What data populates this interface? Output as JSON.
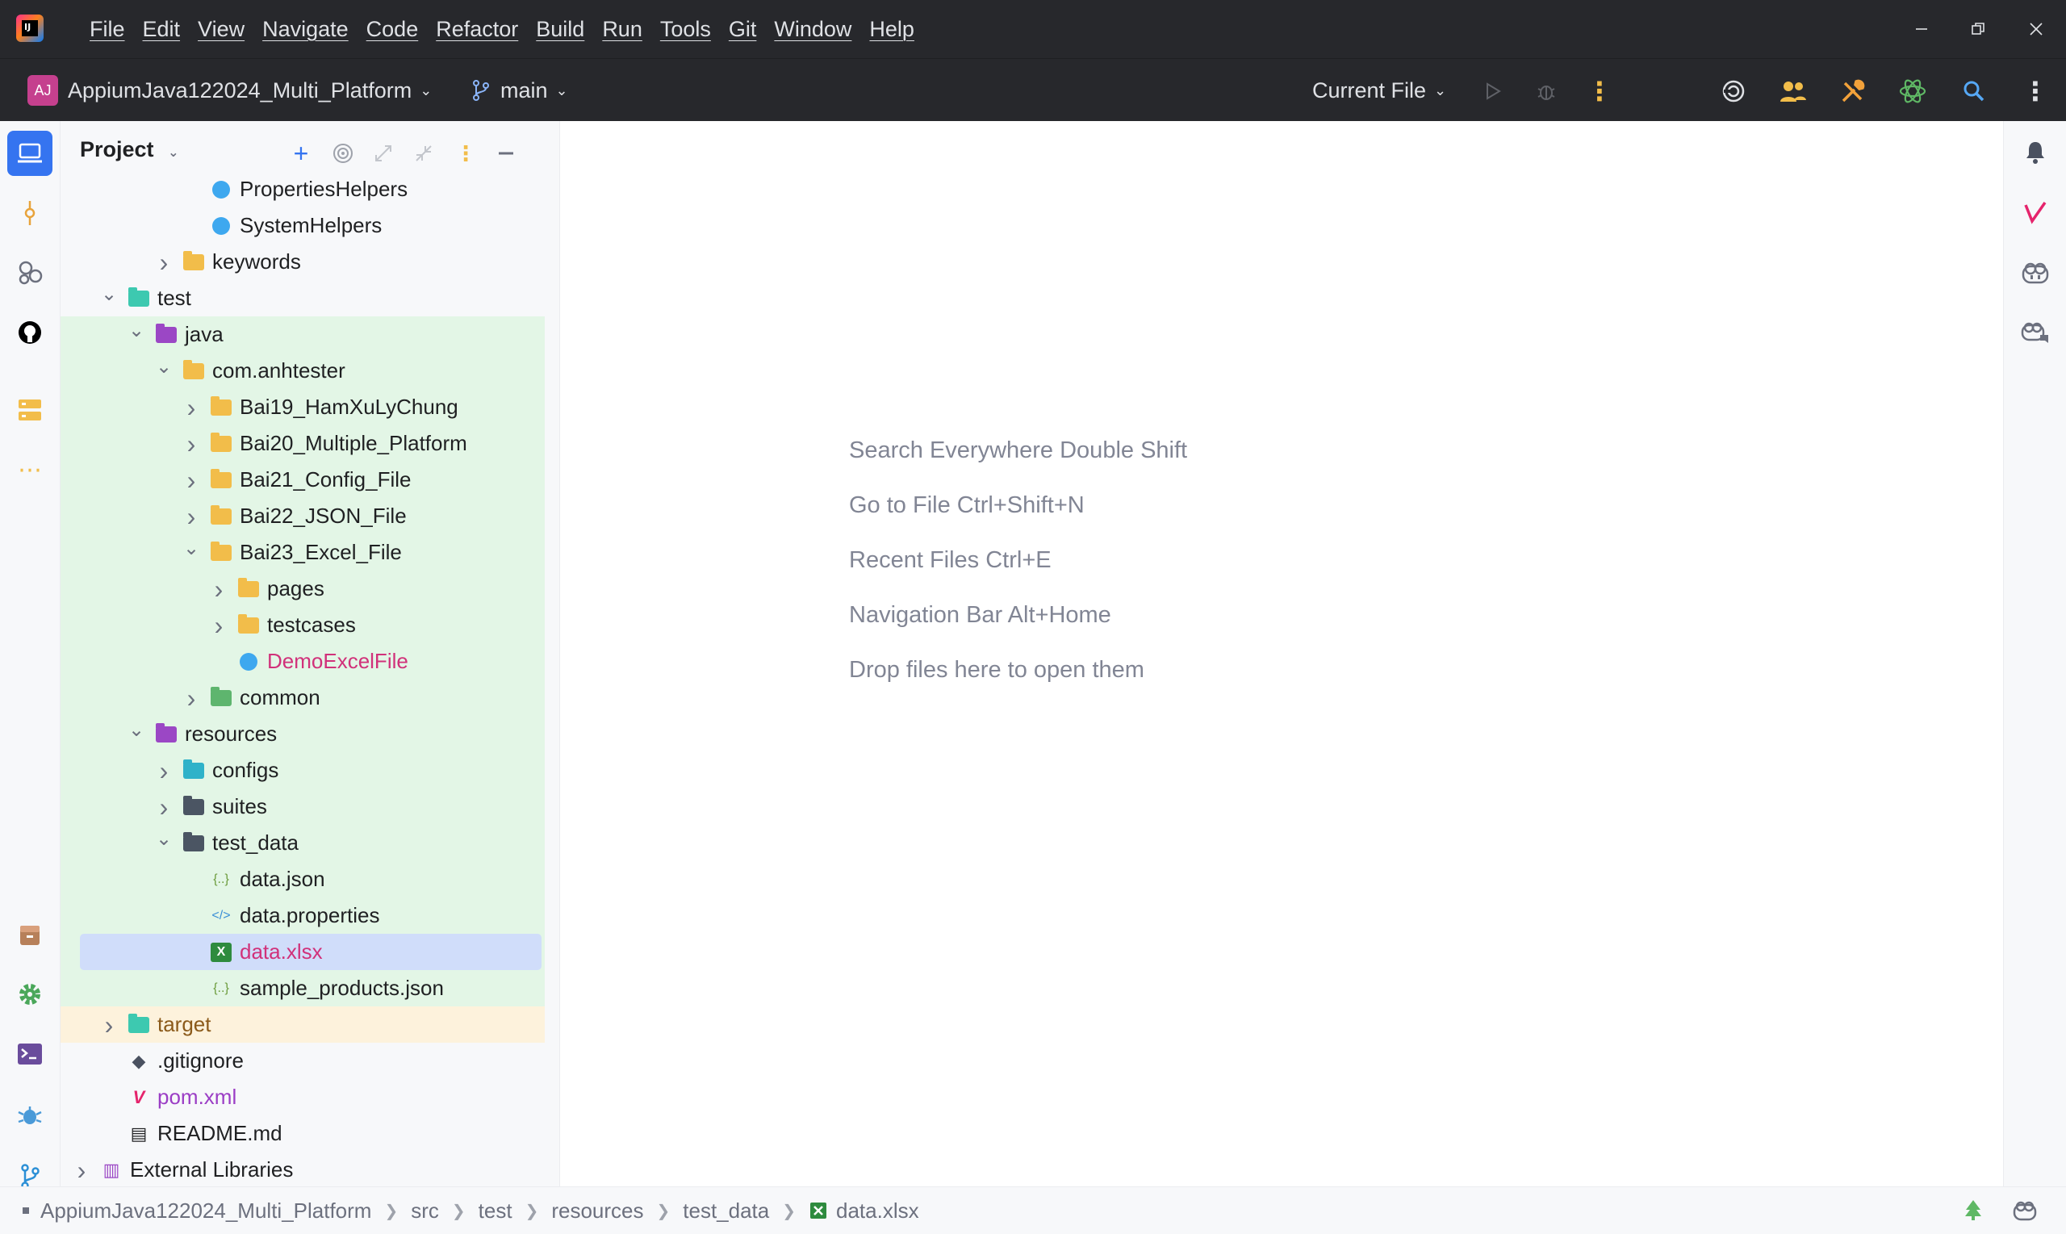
{
  "menu": [
    "File",
    "Edit",
    "View",
    "Navigate",
    "Code",
    "Refactor",
    "Build",
    "Run",
    "Tools",
    "Git",
    "Window",
    "Help"
  ],
  "toolbar": {
    "project_initials": "AJ",
    "project_name": "AppiumJava122024_Multi_Platform",
    "branch": "main",
    "run_config": "Current File"
  },
  "panel": {
    "title": "Project"
  },
  "tree": [
    {
      "label": "PropertiesHelpers",
      "type": "class",
      "depth": 4,
      "arrow": "none",
      "bg": "none",
      "color": "normal"
    },
    {
      "label": "SystemHelpers",
      "type": "class",
      "depth": 4,
      "arrow": "none",
      "bg": "none",
      "color": "normal"
    },
    {
      "label": "keywords",
      "type": "folder",
      "folder": "orange",
      "depth": 3,
      "arrow": "right",
      "bg": "none",
      "color": "normal"
    },
    {
      "label": "test",
      "type": "folder",
      "folder": "teal",
      "depth": 1,
      "arrow": "down",
      "bg": "none",
      "color": "normal"
    },
    {
      "label": "java",
      "type": "folder",
      "folder": "purple",
      "depth": 2,
      "arrow": "down",
      "bg": "green",
      "color": "normal"
    },
    {
      "label": "com.anhtester",
      "type": "folder",
      "folder": "orange",
      "depth": 3,
      "arrow": "down",
      "bg": "green",
      "color": "normal"
    },
    {
      "label": "Bai19_HamXuLyChung",
      "type": "folder",
      "folder": "orange",
      "depth": 4,
      "arrow": "right",
      "bg": "green",
      "color": "normal"
    },
    {
      "label": "Bai20_Multiple_Platform",
      "type": "folder",
      "folder": "orange",
      "depth": 4,
      "arrow": "right",
      "bg": "green",
      "color": "normal"
    },
    {
      "label": "Bai21_Config_File",
      "type": "folder",
      "folder": "orange",
      "depth": 4,
      "arrow": "right",
      "bg": "green",
      "color": "normal"
    },
    {
      "label": "Bai22_JSON_File",
      "type": "folder",
      "folder": "orange",
      "depth": 4,
      "arrow": "right",
      "bg": "green",
      "color": "normal"
    },
    {
      "label": "Bai23_Excel_File",
      "type": "folder",
      "folder": "orange",
      "depth": 4,
      "arrow": "down",
      "bg": "green",
      "color": "normal"
    },
    {
      "label": "pages",
      "type": "folder",
      "folder": "orange",
      "depth": 5,
      "arrow": "right",
      "bg": "green",
      "color": "normal"
    },
    {
      "label": "testcases",
      "type": "folder",
      "folder": "orange",
      "depth": 5,
      "arrow": "right",
      "bg": "green",
      "color": "normal"
    },
    {
      "label": "DemoExcelFile",
      "type": "class",
      "depth": 5,
      "arrow": "none",
      "bg": "green",
      "color": "pink"
    },
    {
      "label": "common",
      "type": "folder",
      "folder": "green",
      "depth": 4,
      "arrow": "right",
      "bg": "green",
      "color": "normal"
    },
    {
      "label": "resources",
      "type": "folder",
      "folder": "purple",
      "depth": 2,
      "arrow": "down",
      "bg": "green",
      "color": "normal"
    },
    {
      "label": "configs",
      "type": "folder",
      "folder": "tealblue",
      "depth": 3,
      "arrow": "right",
      "bg": "green",
      "color": "normal"
    },
    {
      "label": "suites",
      "type": "folder",
      "folder": "dark",
      "depth": 3,
      "arrow": "right",
      "bg": "green",
      "color": "normal"
    },
    {
      "label": "test_data",
      "type": "folder",
      "folder": "dark",
      "depth": 3,
      "arrow": "down",
      "bg": "green",
      "color": "normal"
    },
    {
      "label": "data.json",
      "type": "json",
      "depth": 4,
      "arrow": "none",
      "bg": "green",
      "color": "normal"
    },
    {
      "label": "data.properties",
      "type": "props",
      "depth": 4,
      "arrow": "none",
      "bg": "green",
      "color": "normal"
    },
    {
      "label": "data.xlsx",
      "type": "xlsx",
      "depth": 4,
      "arrow": "none",
      "bg": "green",
      "color": "pink",
      "selected": true
    },
    {
      "label": "sample_products.json",
      "type": "json",
      "depth": 4,
      "arrow": "none",
      "bg": "green",
      "color": "normal"
    },
    {
      "label": "target",
      "type": "folder",
      "folder": "teal",
      "depth": 1,
      "arrow": "right",
      "bg": "yellow",
      "color": "brown"
    },
    {
      "label": ".gitignore",
      "type": "git",
      "depth": 1,
      "arrow": "none",
      "bg": "none",
      "color": "normal"
    },
    {
      "label": "pom.xml",
      "type": "maven",
      "depth": 1,
      "arrow": "none",
      "bg": "none",
      "color": "purple"
    },
    {
      "label": "README.md",
      "type": "md",
      "depth": 1,
      "arrow": "none",
      "bg": "none",
      "color": "normal"
    },
    {
      "label": "External Libraries",
      "type": "lib",
      "depth": 0,
      "arrow": "right",
      "bg": "none",
      "color": "normal"
    }
  ],
  "editor_hints": [
    "Search Everywhere Double Shift",
    "Go to File Ctrl+Shift+N",
    "Recent Files Ctrl+E",
    "Navigation Bar Alt+Home",
    "Drop files here to open them"
  ],
  "status": {
    "breadcrumbs": [
      "AppiumJava122024_Multi_Platform",
      "src",
      "test",
      "resources",
      "test_data",
      "data.xlsx"
    ]
  },
  "colors": {
    "titlebar": "#27282c",
    "panel_bg": "#f7f8fa",
    "green_scope": "#e3f6e6",
    "excluded_scope": "#fdf2dc",
    "selection": "#d0ddfa",
    "accent": "#3574f0"
  }
}
